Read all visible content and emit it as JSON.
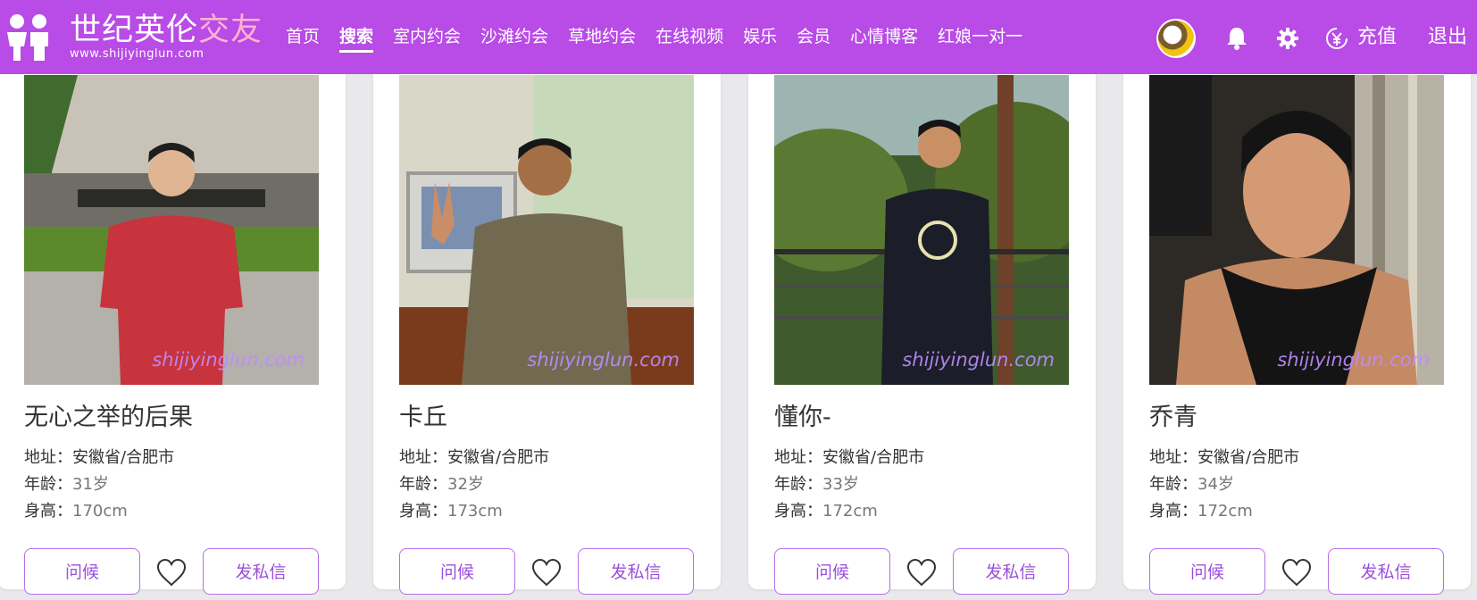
{
  "header": {
    "logo_main": "世纪英伦",
    "logo_highlight": "交友",
    "logo_url": "www.shijiyinglun.com",
    "nav": [
      {
        "label": "首页",
        "active": false
      },
      {
        "label": "搜索",
        "active": true
      },
      {
        "label": "室内约会",
        "active": false
      },
      {
        "label": "沙滩约会",
        "active": false
      },
      {
        "label": "草地约会",
        "active": false
      },
      {
        "label": "在线视频",
        "active": false
      },
      {
        "label": "娱乐",
        "active": false
      },
      {
        "label": "会员",
        "active": false
      },
      {
        "label": "心情博客",
        "active": false
      },
      {
        "label": "红娘一对一",
        "active": false
      }
    ],
    "icons": [
      "avatar",
      "bell-icon",
      "gear-icon",
      "yen-icon"
    ],
    "recharge_label": "充值",
    "logout_label": "退出"
  },
  "watermark": "shijiyinglun.com",
  "labels": {
    "address": "地址：",
    "age": "年龄：",
    "height": "身高：",
    "greet_button": "问候",
    "message_button": "发私信"
  },
  "profiles": [
    {
      "name": "无心之举的后果",
      "address": "安徽省/合肥市",
      "age": "31岁",
      "height": "170cm"
    },
    {
      "name": "卡丘",
      "address": "安徽省/合肥市",
      "age": "32岁",
      "height": "173cm"
    },
    {
      "name": "懂你-",
      "address": "安徽省/合肥市",
      "age": "33岁",
      "height": "172cm"
    },
    {
      "name": "乔青",
      "address": "安徽省/合肥市",
      "age": "34岁",
      "height": "172cm"
    }
  ],
  "colors": {
    "brand": "#b94be6",
    "logo_highlight": "#ffb3d0",
    "button_border": "#b56ee8",
    "button_text": "#9c4fdc",
    "watermark": "#be8cff"
  }
}
